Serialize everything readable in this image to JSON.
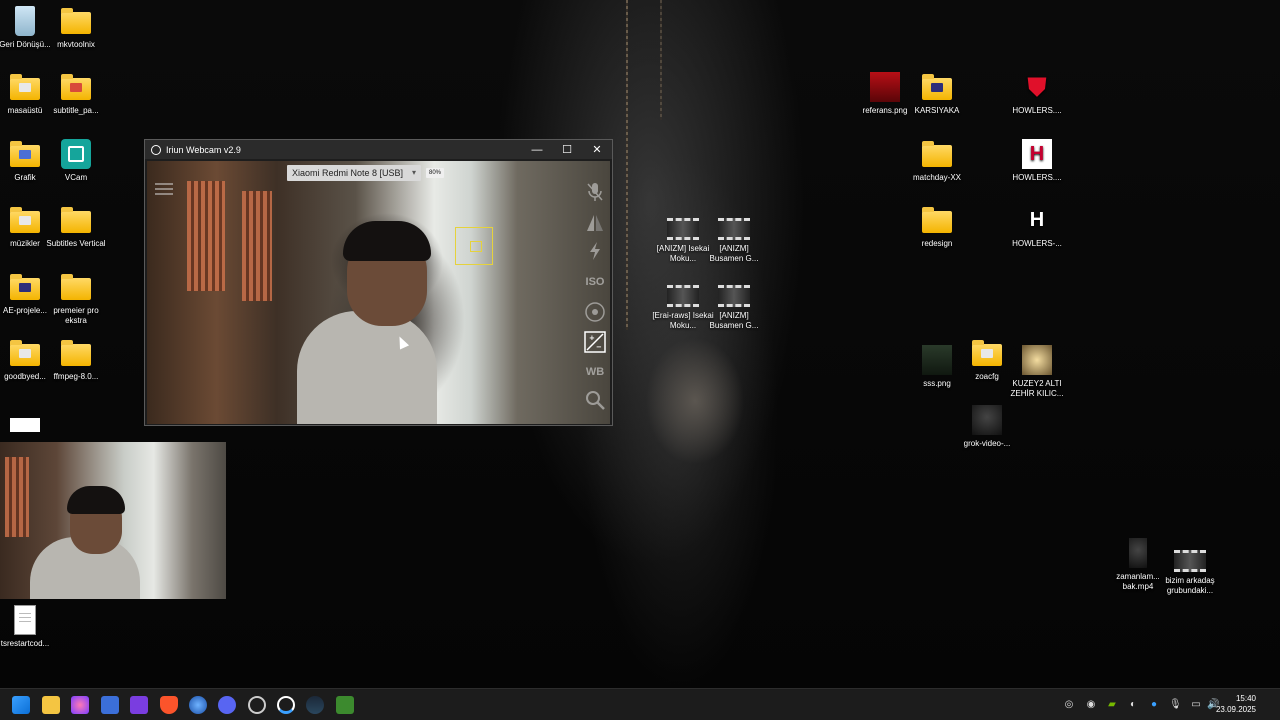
{
  "desktop": {
    "icons": {
      "recycle_bin": "Geri Dönüşü...",
      "mkvtoolnix": "mkvtoolnix",
      "masaustu": "masaüstü",
      "subtitle_pa": "subtitle_pa...",
      "grafik": "Grafik",
      "vcam": "VCam",
      "muzikler": "müzikler",
      "subtitles_vertical": "Subtitles Vertical",
      "ae_projele": "AE-projele...",
      "premeier_pro_ekstra": "premeier pro ekstra",
      "goodbyed": "goodbyed...",
      "ffmpeg": "ffmpeg-8.0...",
      "tsrestartcod": "tsrestartcod...",
      "anizm_isekai": "[ANIZM] Isekai Moku...",
      "anizm_busamen": "[ANIZM] Busamen G...",
      "erai_isekai": "[Erai-raws] Isekai Moku...",
      "anizm_busamen2": "[ANIZM] Busamen G...",
      "referans": "referans.png",
      "karsiyaka": "KARSIYAKA",
      "howlers1": "HOWLERS....",
      "matchday": "matchday-XX",
      "howlers2": "HOWLERS....",
      "redesign": "redesign",
      "howlers3": "HOWLERS-...",
      "sss": "sss.png",
      "zoacfg": "zoacfg",
      "kuzey": "KUZEY2 ALTI ZEHİR KILIC...",
      "grok": "grok-video-...",
      "zamanlam": "zamanlam... bak.mp4",
      "bizim": "bizim arkadaş grubundaki..."
    }
  },
  "webcam_window": {
    "title": "Iriun Webcam v2.9",
    "minimize": "—",
    "maximize": "☐",
    "close": "✕",
    "device": "Xiaomi Redmi Note 8 [USB]",
    "zoom_badge": "80%",
    "controls": {
      "iso": "ISO",
      "wb": "WB"
    }
  },
  "taskbar": {
    "time": "15:40",
    "date": "23.09.2025"
  },
  "colors": {
    "taskbar_bg": "#1c1c1c",
    "window_title_bg": "#2b2b2b",
    "folder_yellow": "#f4b400",
    "lock_frame": "#e5d23c"
  }
}
